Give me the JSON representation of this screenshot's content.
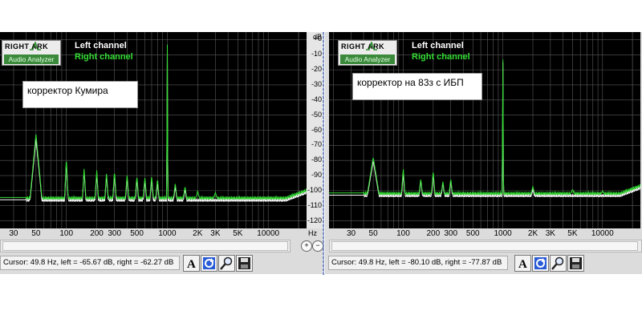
{
  "left_panel": {
    "logo_top": "RIGHT  ARK",
    "logo_bottom": "Audio Analyzer",
    "legend_left": "Left channel",
    "legend_right": "Right channel",
    "annotation": "корректор Кумира",
    "status": "Cursor:  49.8 Hz,  left = -65.67 dB,  right = -62.27 dB",
    "y_unit": "dB",
    "x_unit": "Hz"
  },
  "right_panel": {
    "logo_top": "RIGHT  ARK",
    "logo_bottom": "Audio Analyzer",
    "legend_left": "Left channel",
    "legend_right": "Right channel",
    "annotation": "корректор на 83з с ИБП",
    "status": "Cursor:  49.8 Hz,  left = -80.10 dB,  right = -77.87 dB"
  },
  "colors": {
    "left_channel": "#ffffff",
    "right_channel": "#33dd33",
    "plot_bg": "#000000",
    "grid": "#5a5a5a"
  },
  "icons": [
    "text-A-icon",
    "refresh-icon",
    "zoom-magnifier-icon",
    "save-disk-icon",
    "zoom-in-icon",
    "zoom-out-icon"
  ],
  "chart_data": [
    {
      "type": "line",
      "title": "",
      "xlabel": "Hz",
      "ylabel": "dB",
      "x_scale": "log",
      "xlim": [
        20,
        24000
      ],
      "ylim": [
        -125,
        5
      ],
      "y_ticks": [
        "+0",
        "-10",
        "-20",
        "-30",
        "-40",
        "-50",
        "-60",
        "-70",
        "-80",
        "-90",
        "-100",
        "-110",
        "-120"
      ],
      "x_ticks": [
        {
          "value": 30,
          "label": "30"
        },
        {
          "value": 50,
          "label": "50"
        },
        {
          "value": 100,
          "label": "100"
        },
        {
          "value": 200,
          "label": "200"
        },
        {
          "value": 300,
          "label": "300"
        },
        {
          "value": 500,
          "label": "500"
        },
        {
          "value": 1000,
          "label": "1000"
        },
        {
          "value": 2000,
          "label": "2K"
        },
        {
          "value": 3000,
          "label": "3K"
        },
        {
          "value": 5000,
          "label": "5K"
        },
        {
          "value": 10000,
          "label": "10000"
        }
      ],
      "grid": true,
      "floor_db": -106,
      "series": [
        {
          "name": "Left channel",
          "peaks": [
            [
              50,
              -65.7
            ],
            [
              100,
              -80
            ],
            [
              150,
              -87
            ],
            [
              200,
              -88
            ],
            [
              250,
              -90
            ],
            [
              300,
              -89
            ],
            [
              400,
              -91
            ],
            [
              500,
              -92
            ],
            [
              600,
              -93
            ],
            [
              700,
              -92
            ],
            [
              800,
              -94
            ],
            [
              1000,
              -3
            ],
            [
              1200,
              -97
            ],
            [
              1500,
              -99
            ]
          ]
        },
        {
          "name": "Right channel",
          "peaks": [
            [
              50,
              -62.3
            ],
            [
              100,
              -78
            ],
            [
              150,
              -85
            ],
            [
              200,
              -86
            ],
            [
              250,
              -88
            ],
            [
              300,
              -87
            ],
            [
              400,
              -89
            ],
            [
              500,
              -90
            ],
            [
              600,
              -91
            ],
            [
              700,
              -90
            ],
            [
              800,
              -92
            ],
            [
              1000,
              0
            ],
            [
              1200,
              -95
            ],
            [
              1500,
              -97
            ],
            [
              2000,
              -100
            ],
            [
              3000,
              -101
            ]
          ]
        }
      ]
    },
    {
      "type": "line",
      "title": "",
      "xlabel": "Hz",
      "ylabel": "dB",
      "x_scale": "log",
      "xlim": [
        20,
        24000
      ],
      "ylim": [
        -125,
        5
      ],
      "x_ticks": [
        {
          "value": 30,
          "label": "30"
        },
        {
          "value": 50,
          "label": "50"
        },
        {
          "value": 100,
          "label": "100"
        },
        {
          "value": 200,
          "label": "200"
        },
        {
          "value": 300,
          "label": "300"
        },
        {
          "value": 500,
          "label": "500"
        },
        {
          "value": 1000,
          "label": "1000"
        },
        {
          "value": 2000,
          "label": "2K"
        },
        {
          "value": 3000,
          "label": "3K"
        },
        {
          "value": 5000,
          "label": "5K"
        },
        {
          "value": 10000,
          "label": "10000"
        }
      ],
      "grid": true,
      "floor_db": -103,
      "series": [
        {
          "name": "Left channel",
          "peaks": [
            [
              50,
              -80.1
            ],
            [
              100,
              -88
            ],
            [
              150,
              -93
            ],
            [
              200,
              -89
            ],
            [
              250,
              -95
            ],
            [
              300,
              -93
            ],
            [
              1000,
              -2
            ],
            [
              2000,
              -99
            ]
          ]
        },
        {
          "name": "Right channel",
          "peaks": [
            [
              50,
              -77.9
            ],
            [
              100,
              -85
            ],
            [
              150,
              -92
            ],
            [
              200,
              -87
            ],
            [
              250,
              -94
            ],
            [
              300,
              -92
            ],
            [
              1000,
              0
            ],
            [
              2000,
              -97
            ],
            [
              5000,
              -99
            ],
            [
              10000,
              -100
            ]
          ]
        }
      ]
    }
  ]
}
